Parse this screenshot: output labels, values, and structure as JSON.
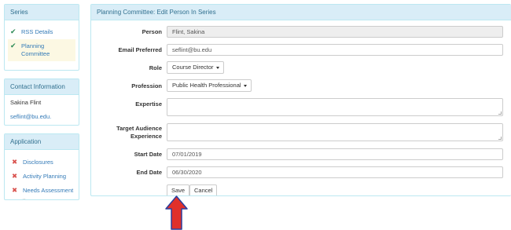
{
  "sidebar": {
    "series": {
      "title": "Series",
      "items": [
        {
          "label": "RSS Details",
          "icon": "check-icon",
          "status": "complete"
        },
        {
          "label": "Planning Committee",
          "icon": "check-icon",
          "status": "complete",
          "active": true
        }
      ]
    },
    "contact": {
      "title": "Contact Information",
      "name": "Sakina Flint",
      "email": "seflint@bu.edu."
    },
    "application": {
      "title": "Application",
      "items": [
        {
          "label": "Disclosures",
          "icon": "x-icon",
          "status": "incomplete"
        },
        {
          "label": "Activity Planning",
          "icon": "x-icon",
          "status": "incomplete"
        },
        {
          "label": "Needs Assessment",
          "icon": "x-icon",
          "status": "incomplete"
        }
      ]
    }
  },
  "main": {
    "title": "Planning Committee: Edit Person In Series",
    "form": {
      "person_label": "Person",
      "person_value": "Flint, Sakina",
      "email_label": "Email Preferred",
      "email_value": "seflint@bu.edu",
      "role_label": "Role",
      "role_value": "Course Director",
      "profession_label": "Profession",
      "profession_value": "Public Health Professional",
      "expertise_label": "Expertise",
      "expertise_value": "",
      "audience_label_line1": "Target Audience",
      "audience_label_line2": "Experience",
      "audience_value": "",
      "start_label": "Start Date",
      "start_value": "07/01/2019",
      "end_label": "End Date",
      "end_value": "06/30/2020",
      "save_label": "Save",
      "cancel_label": "Cancel"
    }
  },
  "colors": {
    "panel_heading_bg": "#d9edf7",
    "panel_heading_text": "#31708f",
    "link": "#337ab7",
    "check": "#2e8b57",
    "x_mark": "#d9534f",
    "active_item_bg": "#fcf8e3",
    "annotation_arrow_fill": "#e0302b",
    "annotation_arrow_outline": "#2a3f9e"
  }
}
